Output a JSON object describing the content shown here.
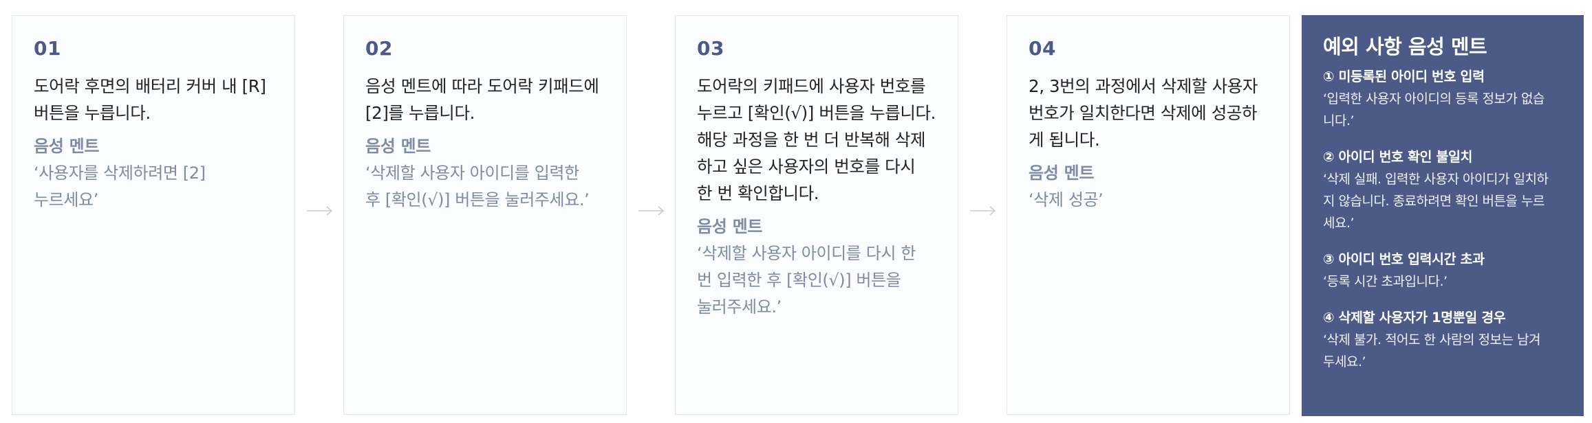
{
  "steps": [
    {
      "number": "01",
      "description": [
        "도어락 후면의 배터리 커버 내 [R]",
        "버튼을 누릅니다."
      ],
      "voice_title": "음성 멘트",
      "voice_text": [
        "‘사용자를 삭제하려면 [2]",
        "누르세요’"
      ]
    },
    {
      "number": "02",
      "description": [
        "음성 멘트에 따라 도어락 키패드에",
        "[2]를 누릅니다."
      ],
      "voice_title": "음성 멘트",
      "voice_text": [
        "‘삭제할 사용자 아이디를 입력한",
        "후 [확인(√)] 버튼을 눌러주세요.’"
      ]
    },
    {
      "number": "03",
      "description": [
        "도어락의 키패드에 사용자 번호를",
        "누르고 [확인(√)] 버튼을 누릅니다.",
        "해당 과정을 한 번 더 반복해 삭제",
        "하고 싶은 사용자의 번호를 다시",
        "한 번 확인합니다."
      ],
      "voice_title": "음성 멘트",
      "voice_text": [
        "‘삭제할 사용자 아이디를 다시 한",
        "번 입력한 후 [확인(√)] 버튼을",
        "눌러주세요.’"
      ]
    },
    {
      "number": "04",
      "description": [
        "2, 3번의 과정에서 삭제할 사용자",
        "번호가 일치한다면 삭제에 성공하",
        "게 됩니다."
      ],
      "voice_title": "음성 멘트",
      "voice_text": [
        "‘삭제 성공’"
      ]
    }
  ],
  "exceptions": {
    "title": "예외 사항 음성 멘트",
    "items": [
      {
        "title": "① 미등록된 아이디 번호 입력",
        "text": [
          "‘입력한 사용자 아이디의 등록 정보가 없습",
          "니다.’"
        ]
      },
      {
        "title": "② 아이디 번호 확인 불일치",
        "text": [
          "‘삭제 실패. 입력한 사용자 아이디가 일치하",
          "지 않습니다. 종료하려면 확인 버튼을 누르",
          "세요.’"
        ]
      },
      {
        "title": "③ 아이디 번호 입력시간 초과",
        "text": [
          "‘등록 시간 초과입니다.’"
        ]
      },
      {
        "title": "④ 삭제할 사용자가 1명뿐일 경우",
        "text": [
          "‘삭제 불가. 적어도 한 사람의 정보는 남겨",
          "두세요.’"
        ]
      }
    ]
  },
  "colors": {
    "accent": "#4b5a86",
    "voice_text": "#7f8aa6",
    "arrow": "#c8ccd6"
  },
  "icons": {
    "step_separator": "arrow-right-icon"
  }
}
